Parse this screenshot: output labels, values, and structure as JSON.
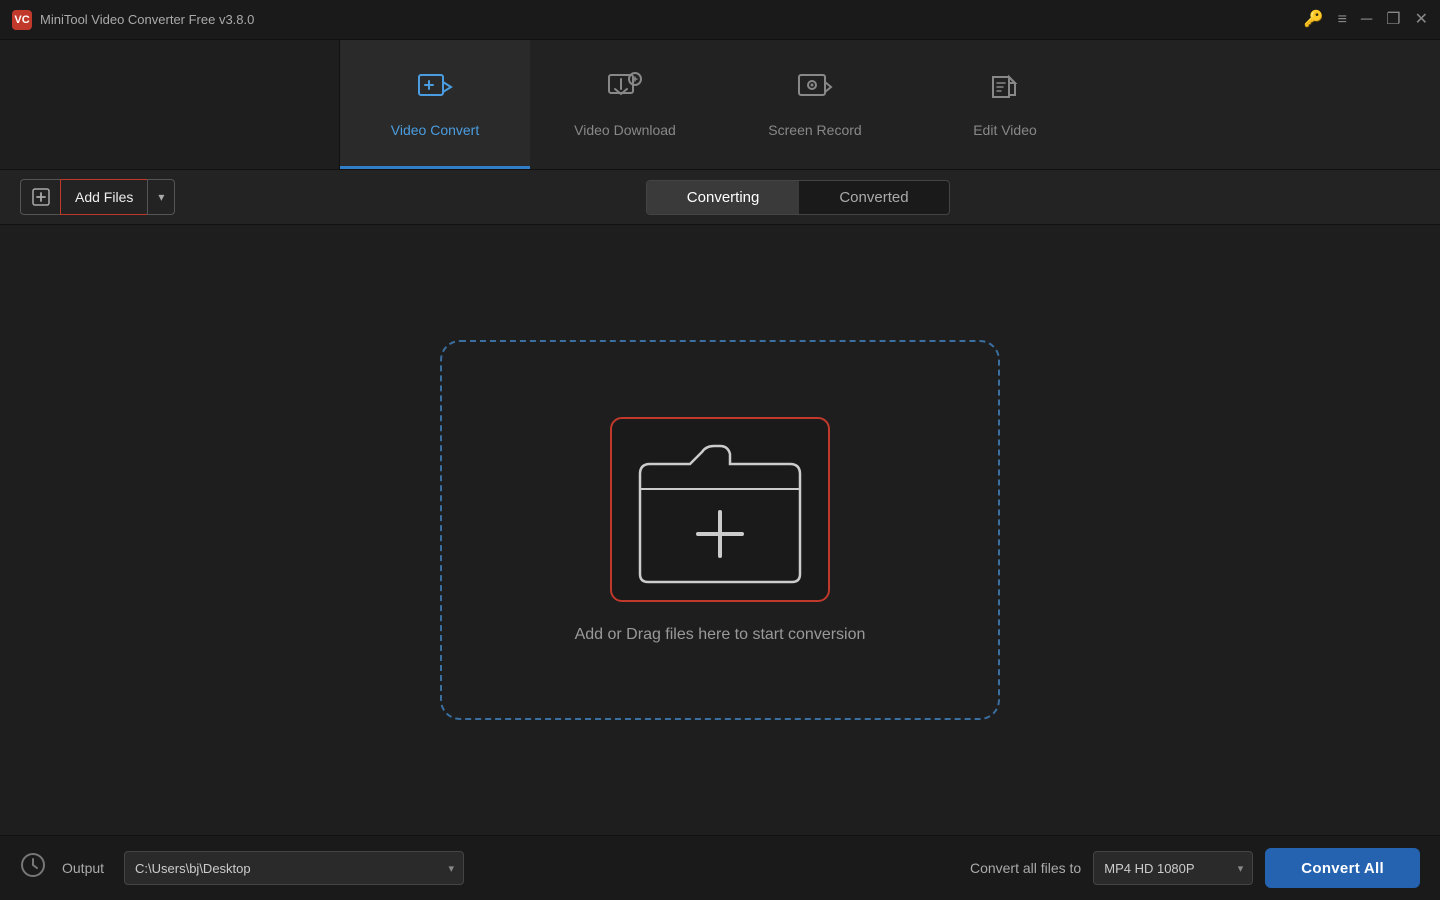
{
  "app": {
    "title": "MiniTool Video Converter Free v3.8.0",
    "logo_text": "VC"
  },
  "titlebar": {
    "controls": {
      "key_icon": "🔑",
      "menu_icon": "≡",
      "minimize_icon": "─",
      "restore_icon": "❐",
      "close_icon": "✕"
    }
  },
  "nav": {
    "tabs": [
      {
        "id": "video-convert",
        "label": "Video Convert",
        "active": true
      },
      {
        "id": "video-download",
        "label": "Video Download",
        "active": false
      },
      {
        "id": "screen-record",
        "label": "Screen Record",
        "active": false
      },
      {
        "id": "edit-video",
        "label": "Edit Video",
        "active": false
      }
    ]
  },
  "toolbar": {
    "add_files_label": "Add Files",
    "converting_tab": "Converting",
    "converted_tab": "Converted"
  },
  "dropzone": {
    "label": "Add or Drag files here to start conversion"
  },
  "footer": {
    "output_label": "Output",
    "output_path": "C:\\Users\\bj\\Desktop",
    "convert_all_label": "Convert all files to",
    "convert_format": "MP4 HD 1080P",
    "convert_all_btn": "Convert All"
  }
}
